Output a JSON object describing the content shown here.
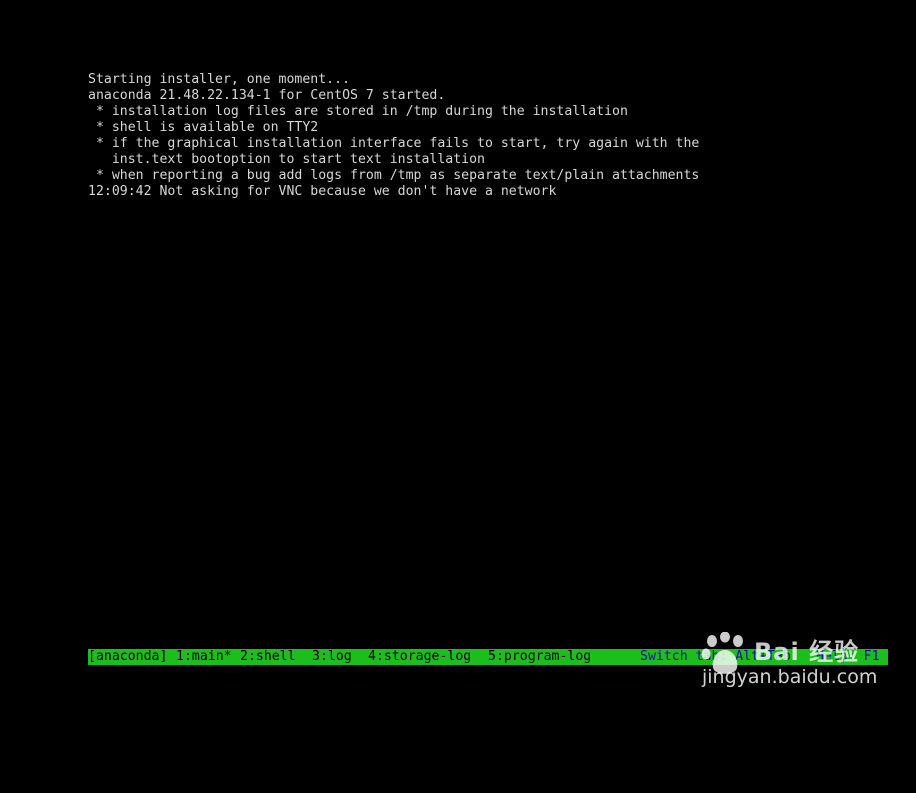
{
  "console": {
    "lines": [
      "Starting installer, one moment...",
      "anaconda 21.48.22.134-1 for CentOS 7 started.",
      " * installation log files are stored in /tmp during the installation",
      " * shell is available on TTY2",
      " * if the graphical installation interface fails to start, try again with the",
      "   inst.text bootoption to start text installation",
      " * when reporting a bug add logs from /tmp as separate text/plain attachments",
      "12:09:42 Not asking for VNC because we don't have a network"
    ]
  },
  "tmux_bar": {
    "session": "[anaconda]",
    "windows": [
      "1:main*",
      "2:shell",
      "3:log",
      "4:storage-log",
      "5:program-log"
    ],
    "switch_hint": "Switch tab: Alt+Tab",
    "help_hint": "Help: F1"
  },
  "watermark": {
    "brand_cn": "Bai 经验",
    "url": "jingyan.baidu.com",
    "icon": "baidu-paw-icon"
  },
  "colors": {
    "background": "#000000",
    "console_text": "#d6d6d6",
    "status_bar": "#1dbd1d",
    "status_text": "#000000",
    "status_hint_text": "#14148c"
  }
}
